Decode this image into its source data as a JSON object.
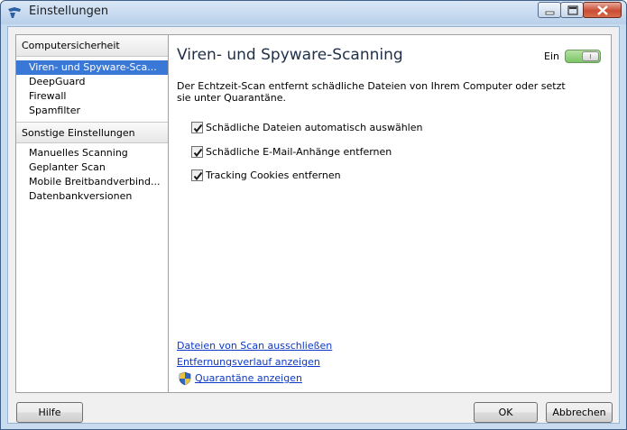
{
  "window": {
    "title": "Einstellungen"
  },
  "sidebar": {
    "groups": [
      {
        "header": "Computersicherheit",
        "items": [
          {
            "label": "Viren- und Spyware-Sca..."
          },
          {
            "label": "DeepGuard"
          },
          {
            "label": "Firewall"
          },
          {
            "label": "Spamfilter"
          }
        ]
      },
      {
        "header": "Sonstige Einstellungen",
        "items": [
          {
            "label": "Manuelles Scanning"
          },
          {
            "label": "Geplanter Scan"
          },
          {
            "label": "Mobile Breitbandverbind..."
          },
          {
            "label": "Datenbankversionen"
          }
        ]
      }
    ]
  },
  "main": {
    "title": "Viren- und Spyware-Scanning",
    "toggle_label": "Ein",
    "toggle_state": "on",
    "description": "Der Echtzeit-Scan entfernt schädliche Dateien von Ihrem Computer oder setzt sie unter Quarantäne.",
    "options": [
      {
        "label": "Schädliche Dateien automatisch auswählen",
        "checked": true
      },
      {
        "label": "Schädliche E-Mail-Anhänge entfernen",
        "checked": true
      },
      {
        "label": "Tracking Cookies entfernen",
        "checked": true
      }
    ],
    "links": [
      {
        "label": "Dateien von Scan ausschließen"
      },
      {
        "label": "Entfernungsverlauf anzeigen"
      },
      {
        "label": "Quarantäne anzeigen",
        "icon": "uac-shield-icon"
      }
    ]
  },
  "footer": {
    "help_label": "Hilfe",
    "ok_label": "OK",
    "cancel_label": "Abbrechen"
  },
  "colors": {
    "selection": "#3a78d8",
    "link": "#0b38c8",
    "toggle_on": "#7bc466"
  }
}
